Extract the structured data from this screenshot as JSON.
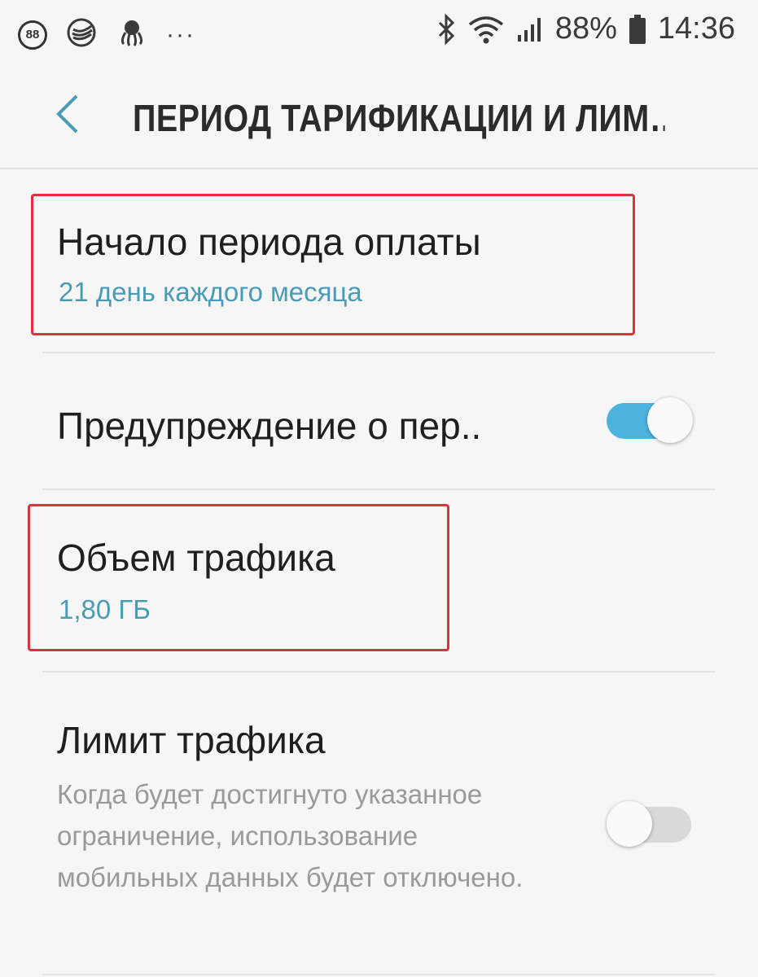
{
  "status_bar": {
    "notification_count": "88",
    "battery_percent": "88%",
    "time": "14:36",
    "overflow": "···",
    "icons": [
      "notification-badge-icon",
      "sberbank-icon",
      "octopus-icon",
      "more-notifications-icon",
      "bluetooth-icon",
      "wifi-icon",
      "signal-icon",
      "battery-icon"
    ]
  },
  "header": {
    "title": "ПЕРИОД ТАРИФИКАЦИИ И ЛИМ…",
    "back_icon": "chevron-left-icon"
  },
  "settings": {
    "billing_start": {
      "title": "Начало периода оплаты",
      "value": "21 день каждого месяца"
    },
    "data_warning": {
      "title": "Предупреждение о пер..",
      "enabled": true
    },
    "data_volume": {
      "title": "Объем трафика",
      "value": "1,80 ГБ"
    },
    "data_limit": {
      "title": "Лимит трафика",
      "description": "Когда будет достигнуто указанное ограничение, использование мобильных данных будет отключено.",
      "enabled": false
    }
  },
  "colors": {
    "accent": "#4cb3df",
    "subtitle": "#4a9bb5",
    "highlight": "#d8343a",
    "background": "#f6f6f6"
  }
}
